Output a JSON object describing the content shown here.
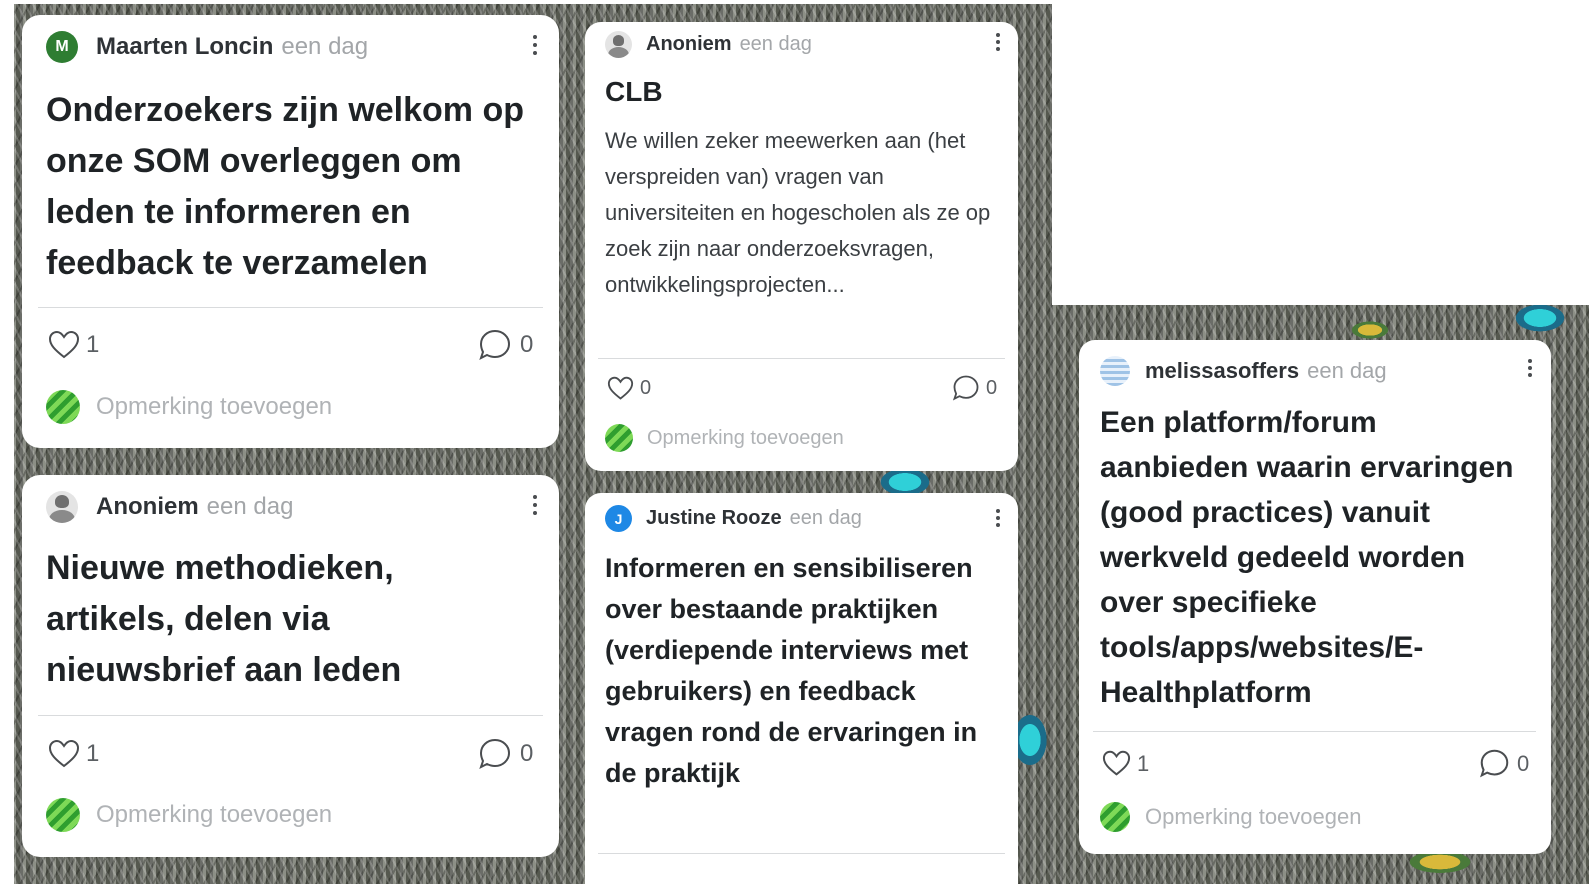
{
  "posts": [
    {
      "author": "Maarten Loncin",
      "avatar_letter": "M",
      "avatar_color": "#2e7d32",
      "time": "een dag",
      "title": "Onderzoekers zijn welkom op onze SOM overleggen om leden te informeren en feedback te verzamelen",
      "likes": "1",
      "comments": "0",
      "add_comment_placeholder": "Opmerking toevoegen"
    },
    {
      "author": "Anoniem",
      "time": "een dag",
      "title": "Nieuwe methodieken, artikels, delen via nieuwsbrief aan leden",
      "likes": "1",
      "comments": "0",
      "add_comment_placeholder": "Opmerking toevoegen"
    },
    {
      "author": "Anoniem",
      "time": "een dag",
      "title": "CLB",
      "body": "We willen zeker meewerken aan (het verspreiden van) vragen van universiteiten en hogescholen als ze op zoek zijn naar onderzoeksvragen, ontwikkelingsprojecten...",
      "likes": "0",
      "comments": "0",
      "add_comment_placeholder": "Opmerking toevoegen"
    },
    {
      "author": "Justine Rooze",
      "avatar_letter": "J",
      "avatar_color": "#1e88e5",
      "time": "een dag",
      "title": "Informeren en sensibiliseren over bestaande praktijken (verdiepende interviews met gebruikers) en feedback vragen rond de ervaringen in de praktijk"
    },
    {
      "author": "melissasoffers",
      "time": "een dag",
      "title": "Een platform/forum aanbieden waarin ervaringen (good practices) vanuit werkveld gedeeld worden over specifieke tools/apps/websites/E-Healthplatform",
      "likes": "1",
      "comments": "0",
      "add_comment_placeholder": "Opmerking toevoegen"
    }
  ],
  "colors": {
    "accent_green": "#2f9e2f",
    "text_dark": "#1f2326",
    "muted": "#a3a6a9"
  }
}
